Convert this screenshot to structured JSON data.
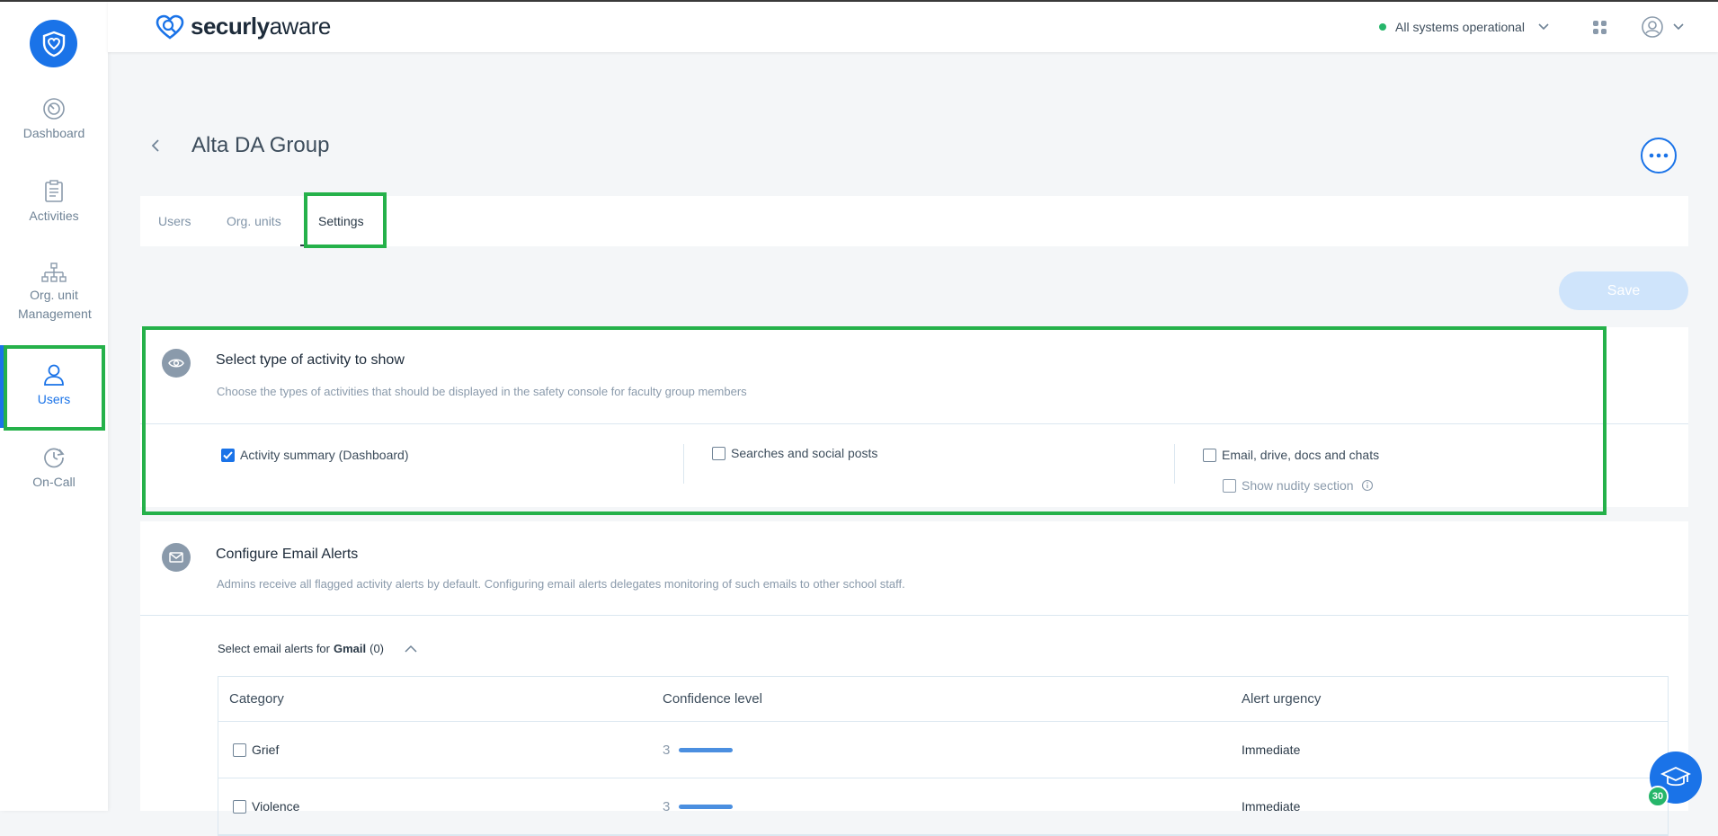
{
  "brand": {
    "name_bold": "securly",
    "name_light": "aware"
  },
  "header": {
    "status": "All systems operational"
  },
  "sidebar": {
    "items": [
      {
        "label": "Dashboard",
        "icon": "dashboard-gauge-icon"
      },
      {
        "label": "Activities",
        "icon": "clipboard-icon"
      },
      {
        "label": "Org. unit Management",
        "icon": "org-chart-icon"
      },
      {
        "label": "Users",
        "icon": "user-icon",
        "active": true
      },
      {
        "label": "On-Call",
        "icon": "on-call-clock-icon"
      }
    ]
  },
  "page": {
    "title": "Alta DA Group"
  },
  "tabs": [
    {
      "label": "Users"
    },
    {
      "label": "Org. units"
    },
    {
      "label": "Settings",
      "active": true
    }
  ],
  "actions": {
    "save": "Save"
  },
  "activity_section": {
    "title": "Select type of activity to show",
    "description": "Choose the types of activities that should be displayed in the safety console for faculty group members",
    "options": [
      {
        "label": "Activity summary (Dashboard)",
        "checked": true
      },
      {
        "label": "Searches and social posts",
        "checked": false
      },
      {
        "label": "Email, drive, docs and chats",
        "checked": false
      },
      {
        "label": "Show nudity section",
        "checked": false
      }
    ]
  },
  "email_section": {
    "title": "Configure Email Alerts",
    "description": "Admins receive all flagged activity alerts by default. Configuring email alerts delegates monitoring of such emails to other school staff.",
    "select_prefix": "Select email alerts for",
    "provider": "Gmail",
    "count": "(0)",
    "table": {
      "headers": [
        "Category",
        "Confidence level",
        "Alert urgency"
      ],
      "rows": [
        {
          "category": "Grief",
          "confidence": "3",
          "urgency": "Immediate"
        },
        {
          "category": "Violence",
          "confidence": "3",
          "urgency": "Immediate"
        }
      ]
    }
  },
  "help": {
    "badge": "30"
  },
  "colors": {
    "accent": "#1a73e8",
    "highlight": "#25b14a",
    "status_ok": "#26b66a"
  }
}
